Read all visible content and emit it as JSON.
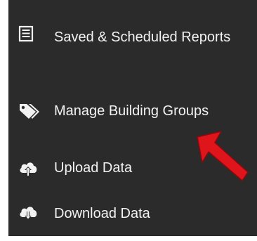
{
  "menu": {
    "items": [
      {
        "label": "Saved & Scheduled Reports",
        "icon": "report-list-icon"
      },
      {
        "label": "Manage Building Groups",
        "icon": "tags-icon"
      },
      {
        "label": "Upload Data",
        "icon": "cloud-upload-icon"
      },
      {
        "label": "Download Data",
        "icon": "cloud-download-icon"
      }
    ]
  },
  "colors": {
    "menu_background": "#2b2b2b",
    "menu_text": "#f2f2f2",
    "annotation_arrow": "#e0141b"
  }
}
